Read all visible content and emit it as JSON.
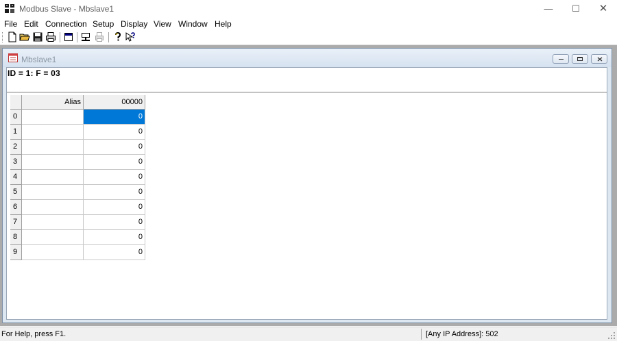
{
  "window": {
    "title": "Modbus Slave - Mbslave1",
    "min_glyph": "—",
    "max_glyph": "☐",
    "close_glyph": "✕"
  },
  "menu": [
    "File",
    "Edit",
    "Connection",
    "Setup",
    "Display",
    "View",
    "Window",
    "Help"
  ],
  "toolbar": {
    "buttons": [
      "new-icon",
      "open-icon",
      "save-icon",
      "print-icon",
      "window-icon",
      "connect-icon",
      "disconnect-icon",
      "help-icon",
      "context-help-icon"
    ]
  },
  "child": {
    "title": "Mbslave1",
    "id_line": "ID = 1: F = 03"
  },
  "grid": {
    "headers": [
      "Alias",
      "00000"
    ],
    "rows": [
      {
        "index": "0",
        "alias": "",
        "value": "0"
      },
      {
        "index": "1",
        "alias": "",
        "value": "0"
      },
      {
        "index": "2",
        "alias": "",
        "value": "0"
      },
      {
        "index": "3",
        "alias": "",
        "value": "0"
      },
      {
        "index": "4",
        "alias": "",
        "value": "0"
      },
      {
        "index": "5",
        "alias": "",
        "value": "0"
      },
      {
        "index": "6",
        "alias": "",
        "value": "0"
      },
      {
        "index": "7",
        "alias": "",
        "value": "0"
      },
      {
        "index": "8",
        "alias": "",
        "value": "0"
      },
      {
        "index": "9",
        "alias": "",
        "value": "0"
      }
    ],
    "selected_row": 0,
    "selected_color": "#0078d7"
  },
  "status": {
    "help": "For Help, press F1.",
    "connection": "[Any IP Address]: 502"
  }
}
